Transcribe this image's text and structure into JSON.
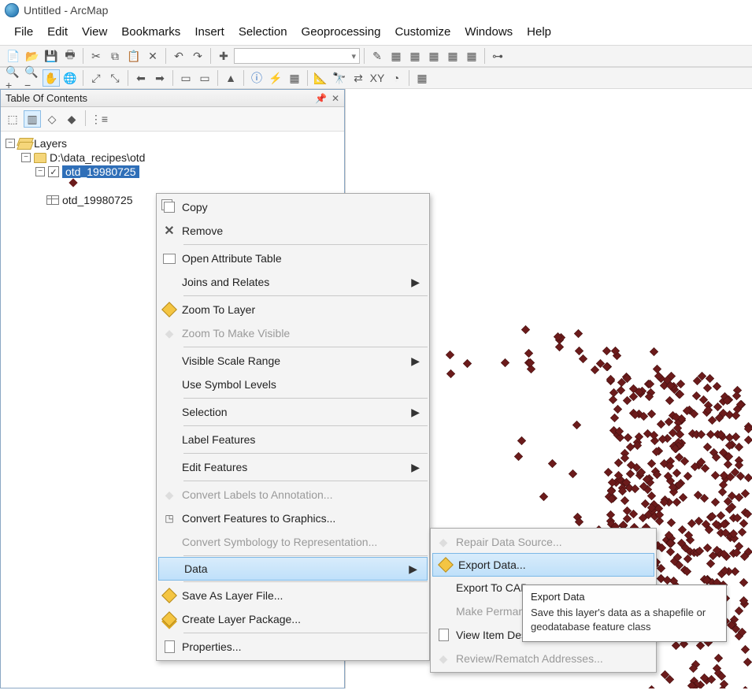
{
  "window": {
    "title": "Untitled - ArcMap"
  },
  "menubar": [
    "File",
    "Edit",
    "View",
    "Bookmarks",
    "Insert",
    "Selection",
    "Geoprocessing",
    "Customize",
    "Windows",
    "Help"
  ],
  "toc": {
    "title": "Table Of Contents",
    "root": "Layers",
    "folder_path": "D:\\data_recipes\\otd",
    "selected_layer": "otd_19980725",
    "table_layer": "otd_19980725"
  },
  "context1": {
    "items": [
      {
        "label": "Copy",
        "icon": "copy",
        "arrow": false,
        "disabled": false
      },
      {
        "label": "Remove",
        "icon": "x",
        "arrow": false,
        "disabled": false
      },
      {
        "hr": true
      },
      {
        "label": "Open Attribute Table",
        "icon": "table",
        "arrow": false,
        "disabled": false
      },
      {
        "label": "Joins and Relates",
        "icon": "",
        "arrow": true,
        "disabled": false
      },
      {
        "hr": true
      },
      {
        "label": "Zoom To Layer",
        "icon": "diamond",
        "arrow": false,
        "disabled": false
      },
      {
        "label": "Zoom To Make Visible",
        "icon": "gray",
        "arrow": false,
        "disabled": true
      },
      {
        "hr": true
      },
      {
        "label": "Visible Scale Range",
        "icon": "",
        "arrow": true,
        "disabled": false
      },
      {
        "label": "Use Symbol Levels",
        "icon": "",
        "arrow": false,
        "disabled": false
      },
      {
        "hr": true
      },
      {
        "label": "Selection",
        "icon": "",
        "arrow": true,
        "disabled": false
      },
      {
        "hr": true
      },
      {
        "label": "Label Features",
        "icon": "",
        "arrow": false,
        "disabled": false
      },
      {
        "hr": true
      },
      {
        "label": "Edit Features",
        "icon": "",
        "arrow": true,
        "disabled": false
      },
      {
        "hr": true
      },
      {
        "label": "Convert Labels to Annotation...",
        "icon": "gray",
        "arrow": false,
        "disabled": true
      },
      {
        "label": "Convert Features to Graphics...",
        "icon": "graphic",
        "arrow": false,
        "disabled": false
      },
      {
        "label": "Convert Symbology to Representation...",
        "icon": "",
        "arrow": false,
        "disabled": true
      },
      {
        "hr": true
      },
      {
        "label": "Data",
        "icon": "",
        "arrow": true,
        "disabled": false,
        "highlight": true
      },
      {
        "hr": true
      },
      {
        "label": "Save As Layer File...",
        "icon": "diamond",
        "arrow": false,
        "disabled": false
      },
      {
        "label": "Create Layer Package...",
        "icon": "diamond2",
        "arrow": false,
        "disabled": false
      },
      {
        "hr": true
      },
      {
        "label": "Properties...",
        "icon": "paper",
        "arrow": false,
        "disabled": false
      }
    ]
  },
  "context2": {
    "items": [
      {
        "label": "Repair Data Source...",
        "icon": "gray",
        "disabled": true
      },
      {
        "label": "Export Data...",
        "icon": "diamond",
        "disabled": false,
        "highlight": true
      },
      {
        "label": "Export To CAD...",
        "icon": "",
        "disabled": false
      },
      {
        "label": "Make Permanent",
        "icon": "",
        "disabled": true
      },
      {
        "label": "View Item Description...",
        "icon": "paper",
        "disabled": false
      },
      {
        "label": "Review/Rematch Addresses...",
        "icon": "gray",
        "disabled": true
      }
    ]
  },
  "tooltip": {
    "title": "Export Data",
    "body": "Save this layer's data as a shapefile or geodatabase feature class"
  }
}
